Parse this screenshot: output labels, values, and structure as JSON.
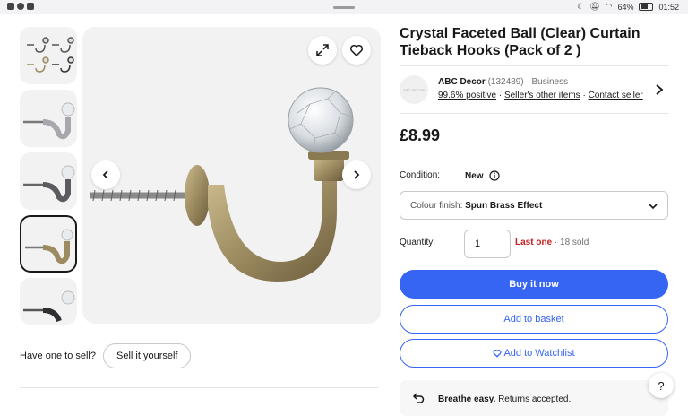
{
  "status_bar": {
    "battery": "64%",
    "time": "01:52"
  },
  "product": {
    "title": "Crystal Faceted Ball (Clear) Curtain Tieback Hooks (Pack of 2 )",
    "price": "£8.99"
  },
  "seller": {
    "logo_text": "ABC DECOR",
    "name": "ABC Decor",
    "feedback_count": "(132489)",
    "type": "· Business",
    "positive": "99.6% positive",
    "sep1": "·",
    "other_items": "Seller's other items",
    "sep2": "·",
    "contact": "Contact seller"
  },
  "condition": {
    "label": "Condition:",
    "value": "New"
  },
  "variation": {
    "label": "Colour finish:",
    "value": "Spun Brass Effect"
  },
  "quantity": {
    "label": "Quantity:",
    "value": "1",
    "stock": "Last one",
    "sold": "· 18 sold"
  },
  "buttons": {
    "buy_now": "Buy it now",
    "add_to_basket": "Add to basket",
    "add_to_watchlist": "Add to Watchlist"
  },
  "sell": {
    "question": "Have one to sell?",
    "button": "Sell it yourself"
  },
  "returns": {
    "bold": "Breathe easy.",
    "text": "Returns accepted."
  },
  "help": {
    "label": "?"
  },
  "gallery": {
    "selected_index": 3
  },
  "colors": {
    "accent": "#3665f3",
    "stock_red": "#c41e1e",
    "image_bg": "#f2f2f2",
    "brass": "#9c8a60"
  }
}
